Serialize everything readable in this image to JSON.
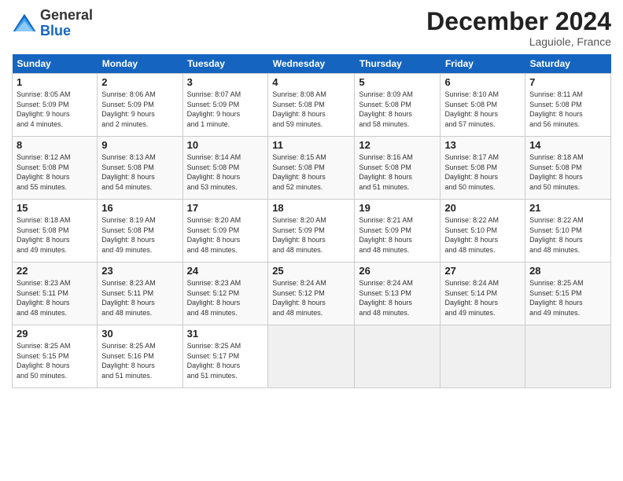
{
  "header": {
    "logo_line1": "General",
    "logo_line2": "Blue",
    "month": "December 2024",
    "location": "Laguiole, France"
  },
  "weekdays": [
    "Sunday",
    "Monday",
    "Tuesday",
    "Wednesday",
    "Thursday",
    "Friday",
    "Saturday"
  ],
  "weeks": [
    [
      {
        "day": "1",
        "info": "Sunrise: 8:05 AM\nSunset: 5:09 PM\nDaylight: 9 hours\nand 4 minutes."
      },
      {
        "day": "2",
        "info": "Sunrise: 8:06 AM\nSunset: 5:09 PM\nDaylight: 9 hours\nand 2 minutes."
      },
      {
        "day": "3",
        "info": "Sunrise: 8:07 AM\nSunset: 5:09 PM\nDaylight: 9 hours\nand 1 minute."
      },
      {
        "day": "4",
        "info": "Sunrise: 8:08 AM\nSunset: 5:08 PM\nDaylight: 8 hours\nand 59 minutes."
      },
      {
        "day": "5",
        "info": "Sunrise: 8:09 AM\nSunset: 5:08 PM\nDaylight: 8 hours\nand 58 minutes."
      },
      {
        "day": "6",
        "info": "Sunrise: 8:10 AM\nSunset: 5:08 PM\nDaylight: 8 hours\nand 57 minutes."
      },
      {
        "day": "7",
        "info": "Sunrise: 8:11 AM\nSunset: 5:08 PM\nDaylight: 8 hours\nand 56 minutes."
      }
    ],
    [
      {
        "day": "8",
        "info": "Sunrise: 8:12 AM\nSunset: 5:08 PM\nDaylight: 8 hours\nand 55 minutes."
      },
      {
        "day": "9",
        "info": "Sunrise: 8:13 AM\nSunset: 5:08 PM\nDaylight: 8 hours\nand 54 minutes."
      },
      {
        "day": "10",
        "info": "Sunrise: 8:14 AM\nSunset: 5:08 PM\nDaylight: 8 hours\nand 53 minutes."
      },
      {
        "day": "11",
        "info": "Sunrise: 8:15 AM\nSunset: 5:08 PM\nDaylight: 8 hours\nand 52 minutes."
      },
      {
        "day": "12",
        "info": "Sunrise: 8:16 AM\nSunset: 5:08 PM\nDaylight: 8 hours\nand 51 minutes."
      },
      {
        "day": "13",
        "info": "Sunrise: 8:17 AM\nSunset: 5:08 PM\nDaylight: 8 hours\nand 50 minutes."
      },
      {
        "day": "14",
        "info": "Sunrise: 8:18 AM\nSunset: 5:08 PM\nDaylight: 8 hours\nand 50 minutes."
      }
    ],
    [
      {
        "day": "15",
        "info": "Sunrise: 8:18 AM\nSunset: 5:08 PM\nDaylight: 8 hours\nand 49 minutes."
      },
      {
        "day": "16",
        "info": "Sunrise: 8:19 AM\nSunset: 5:08 PM\nDaylight: 8 hours\nand 49 minutes."
      },
      {
        "day": "17",
        "info": "Sunrise: 8:20 AM\nSunset: 5:09 PM\nDaylight: 8 hours\nand 48 minutes."
      },
      {
        "day": "18",
        "info": "Sunrise: 8:20 AM\nSunset: 5:09 PM\nDaylight: 8 hours\nand 48 minutes."
      },
      {
        "day": "19",
        "info": "Sunrise: 8:21 AM\nSunset: 5:09 PM\nDaylight: 8 hours\nand 48 minutes."
      },
      {
        "day": "20",
        "info": "Sunrise: 8:22 AM\nSunset: 5:10 PM\nDaylight: 8 hours\nand 48 minutes."
      },
      {
        "day": "21",
        "info": "Sunrise: 8:22 AM\nSunset: 5:10 PM\nDaylight: 8 hours\nand 48 minutes."
      }
    ],
    [
      {
        "day": "22",
        "info": "Sunrise: 8:23 AM\nSunset: 5:11 PM\nDaylight: 8 hours\nand 48 minutes."
      },
      {
        "day": "23",
        "info": "Sunrise: 8:23 AM\nSunset: 5:11 PM\nDaylight: 8 hours\nand 48 minutes."
      },
      {
        "day": "24",
        "info": "Sunrise: 8:23 AM\nSunset: 5:12 PM\nDaylight: 8 hours\nand 48 minutes."
      },
      {
        "day": "25",
        "info": "Sunrise: 8:24 AM\nSunset: 5:12 PM\nDaylight: 8 hours\nand 48 minutes."
      },
      {
        "day": "26",
        "info": "Sunrise: 8:24 AM\nSunset: 5:13 PM\nDaylight: 8 hours\nand 48 minutes."
      },
      {
        "day": "27",
        "info": "Sunrise: 8:24 AM\nSunset: 5:14 PM\nDaylight: 8 hours\nand 49 minutes."
      },
      {
        "day": "28",
        "info": "Sunrise: 8:25 AM\nSunset: 5:15 PM\nDaylight: 8 hours\nand 49 minutes."
      }
    ],
    [
      {
        "day": "29",
        "info": "Sunrise: 8:25 AM\nSunset: 5:15 PM\nDaylight: 8 hours\nand 50 minutes."
      },
      {
        "day": "30",
        "info": "Sunrise: 8:25 AM\nSunset: 5:16 PM\nDaylight: 8 hours\nand 51 minutes."
      },
      {
        "day": "31",
        "info": "Sunrise: 8:25 AM\nSunset: 5:17 PM\nDaylight: 8 hours\nand 51 minutes."
      },
      null,
      null,
      null,
      null
    ]
  ]
}
